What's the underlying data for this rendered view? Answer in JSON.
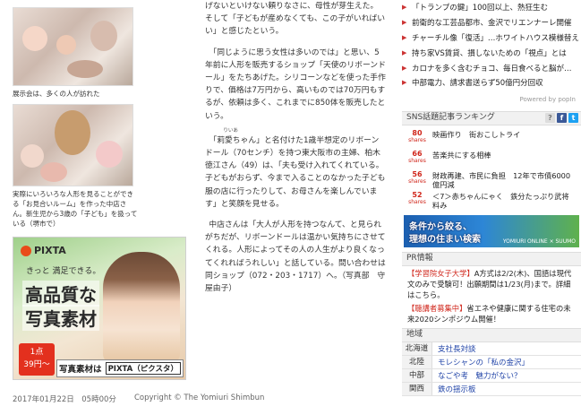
{
  "left": {
    "caption1": "展示会は、多くの人が訪れた",
    "caption2": "実際にいろいろな人形を見ることができる「お見合いルーム」を作った中店さん。新生児から3歳の「子ども」を扱っている（堺市で）"
  },
  "ad": {
    "brand": "PIXTA",
    "small_text": "きっと 満足できる。",
    "headline1": "高品質な",
    "headline2": "写真素材",
    "price_line1": "1点",
    "price_line2": "39円〜",
    "strip_label": "写真素材は",
    "strip_brand": "PIXTA（ピクスタ）"
  },
  "article": {
    "p1": "げないといけない頼りなさに、母性が芽生えた。そして「子どもが産めなくても、この子がいればいい」と感じたという。",
    "p2": "「同じように思う女性は多いのでは」と思い、5年前に人形を販売するショップ「天使のリボーンドール」をたちあげた。シリコーンなどを使った手作りで、価格は7万円から、高いものでは70万円もするが、依頼は多く、これまでに850体を販売したという。",
    "p3_ruby": "りいあ",
    "p3": "「莉愛ちゃん」と名付けた1歳半想定のリボーンドール（70センチ）を持つ東大阪市の主婦、柏木徳江さん（49）は、「夫も受け入れてくれている。子どもがおらず、今まで入ることのなかった子ども服の店に行ったりして、お母さんを楽しんでいます」と笑顔を見せる。",
    "p4": "中店さんは「大人が人形を持つなんて、と見られがちだが、リボーンドールは温かい気持ちにさせてくれる。人形によってその人の人生がより良くなってくれればうれしい」と話している。問い合わせは同ショップ（072・203・1717）へ。（写真部　守屋由子）"
  },
  "footer": {
    "date": "2017年01月22日　05時00分",
    "copyright": "Copyright © The Yomiuri Shimbun"
  },
  "popular": {
    "items": [
      "「トランプの鍵」100回以上、熱狂生む",
      "前衛的な工芸品都市、金沢でリエンナーレ開催",
      "チャーチル像「復活」…ホワイトハウス模様替え",
      "持ち家VS賃貸、損しないための「視点」とは",
      "カロナを多く含むチョコ、毎日食べると脳が…",
      "中部電力、請求書送らず50億円分回収"
    ],
    "powered": "Powered by popIn"
  },
  "sns": {
    "heading": "SNS話題記事ランキング",
    "items": [
      {
        "count": "80",
        "unit": "shares",
        "title": "映画作り　街おこしトライ"
      },
      {
        "count": "66",
        "unit": "shares",
        "title": "苦楽共にする相棒"
      },
      {
        "count": "56",
        "unit": "shares",
        "title": "財政再建、市民に負担　12年で市債6000億円減"
      },
      {
        "count": "52",
        "unit": "shares",
        "title": "＜7＞赤ちゃんにゃく　鉄分たっぷり武将料み"
      }
    ]
  },
  "banner": {
    "line1": "条件から絞る、",
    "line2": "理想の住まい検索",
    "credit": "YOMIURI ONLINE × SUUMO"
  },
  "pr": {
    "heading": "PR情報",
    "items": [
      {
        "tag": "【学習院女子大学】",
        "text": "A方式は2/2(木)、国語は現代文のみで受験可！出願期間は1/23(月)まで。詳細はこちら。"
      },
      {
        "tag": "【聴講者募集中】",
        "text": "省エネや健康に関する住宅の未来2020シンポジウム開催！"
      }
    ]
  },
  "region": {
    "heading": "地域",
    "items": [
      {
        "name": "北海道",
        "text": "支社長対談"
      },
      {
        "name": "北陸",
        "text": "モレシャンの「私の金沢」"
      },
      {
        "name": "中部",
        "text": "なごや考　魅力がない？"
      },
      {
        "name": "関西",
        "text": "鉄の揺示板"
      }
    ]
  },
  "colors": {
    "accent_red": "#d0261b",
    "link_blue": "#2245a8"
  }
}
